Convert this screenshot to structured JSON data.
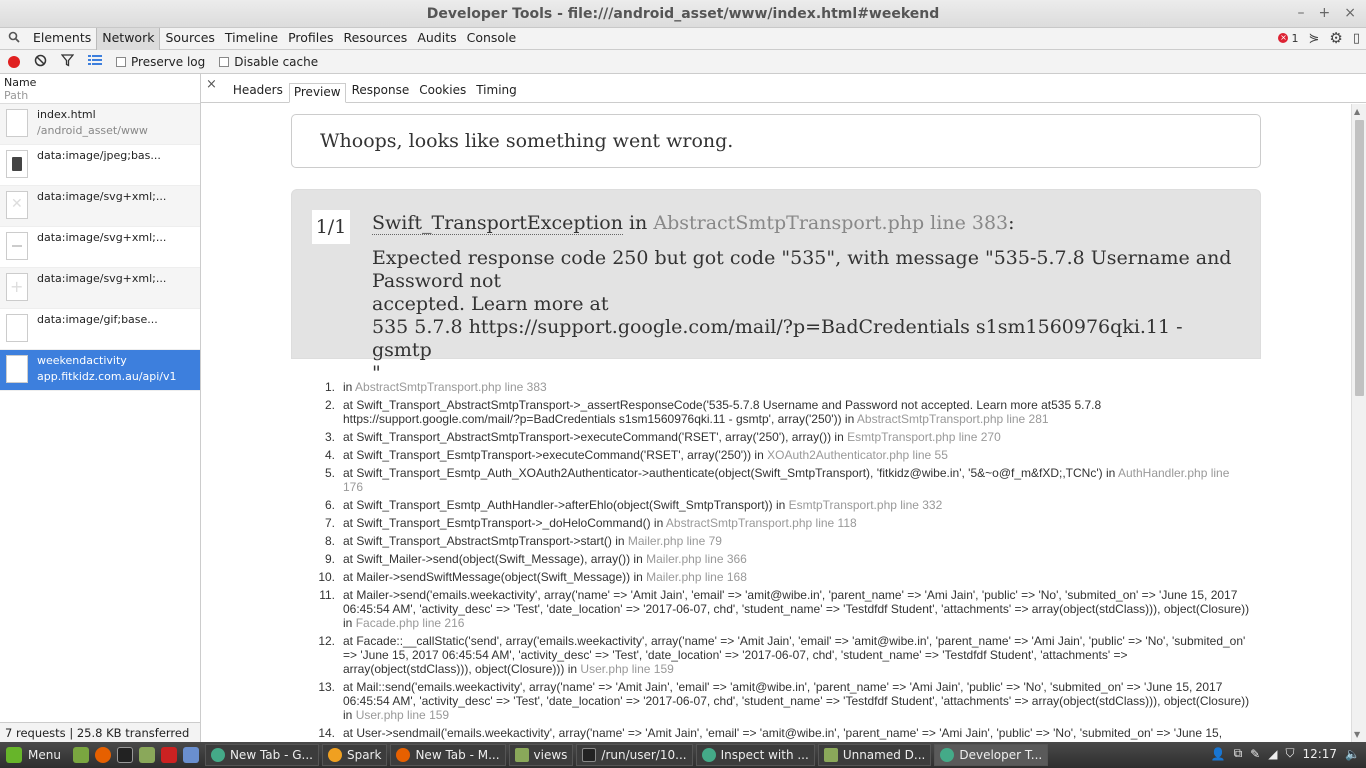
{
  "window": {
    "title": "Developer Tools - file:///android_asset/www/index.html#weekend"
  },
  "devtools_tabs": [
    "Elements",
    "Network",
    "Sources",
    "Timeline",
    "Profiles",
    "Resources",
    "Audits",
    "Console"
  ],
  "error_count": "1",
  "toolbar": {
    "preserve_log": "Preserve log",
    "disable_cache": "Disable cache"
  },
  "list": {
    "name_header": "Name",
    "path_header": "Path",
    "requests": [
      {
        "name": "index.html",
        "path": "/android_asset/www"
      },
      {
        "name": "data:image/jpeg;bas...",
        "path": ""
      },
      {
        "name": "data:image/svg+xml;...",
        "path": ""
      },
      {
        "name": "data:image/svg+xml;...",
        "path": ""
      },
      {
        "name": "data:image/svg+xml;...",
        "path": ""
      },
      {
        "name": "data:image/gif;base...",
        "path": ""
      },
      {
        "name": "weekendactivity",
        "path": "app.fitkidz.com.au/api/v1"
      }
    ],
    "footer": "7 requests  |  25.8 KB transferred"
  },
  "detail_tabs": [
    "Headers",
    "Preview",
    "Response",
    "Cookies",
    "Timing"
  ],
  "preview": {
    "whoops": "Whoops, looks like something went wrong.",
    "counter": "1/1",
    "exception_class": "Swift_TransportException",
    "in_text": "in",
    "exception_file": "AbstractSmtpTransport.php line 383",
    "message_lines": [
      "Expected response code 250 but got code \"535\", with message \"535-5.7.8 Username and Password not",
      "accepted. Learn more at",
      "535 5.7.8 https://support.google.com/mail/?p=BadCredentials s1sm1560976qki.11 - gsmtp",
      "\""
    ],
    "trace": [
      {
        "no": "1.",
        "text": "in",
        "file": "AbstractSmtpTransport.php line 383"
      },
      {
        "no": "2.",
        "text": "at Swift_Transport_AbstractSmtpTransport->_assertResponseCode('535-5.7.8 Username and Password not accepted. Learn more at535 5.7.8 https://support.google.com/mail/?p=BadCredentials s1sm1560976qki.11 - gsmtp', array('250')) in",
        "file": "AbstractSmtpTransport.php line 281"
      },
      {
        "no": "3.",
        "text": "at Swift_Transport_AbstractSmtpTransport->executeCommand('RSET', array('250'), array()) in",
        "file": "EsmtpTransport.php line 270"
      },
      {
        "no": "4.",
        "text": "at Swift_Transport_EsmtpTransport->executeCommand('RSET', array('250')) in",
        "file": "XOAuth2Authenticator.php line 55"
      },
      {
        "no": "5.",
        "text": "at Swift_Transport_Esmtp_Auth_XOAuth2Authenticator->authenticate(object(Swift_SmtpTransport), 'fitkidz@wibe.in', '5&~o@f_m&fXD;,TCNc') in",
        "file": "AuthHandler.php line 176"
      },
      {
        "no": "6.",
        "text": "at Swift_Transport_Esmtp_AuthHandler->afterEhlo(object(Swift_SmtpTransport)) in",
        "file": "EsmtpTransport.php line 332"
      },
      {
        "no": "7.",
        "text": "at Swift_Transport_EsmtpTransport->_doHeloCommand() in",
        "file": "AbstractSmtpTransport.php line 118"
      },
      {
        "no": "8.",
        "text": "at Swift_Transport_AbstractSmtpTransport->start() in",
        "file": "Mailer.php line 79"
      },
      {
        "no": "9.",
        "text": "at Swift_Mailer->send(object(Swift_Message), array()) in",
        "file": "Mailer.php line 366"
      },
      {
        "no": "10.",
        "text": "at Mailer->sendSwiftMessage(object(Swift_Message)) in",
        "file": "Mailer.php line 168"
      },
      {
        "no": "11.",
        "text": "at Mailer->send('emails.weekactivity', array('name' => 'Amit Jain', 'email' => 'amit@wibe.in', 'parent_name' => 'Ami Jain', 'public' => 'No', 'submited_on' => 'June 15, 2017 06:45:54 AM', 'activity_desc' => 'Test', 'date_location' => '2017-06-07, chd', 'student_name' => 'Testdfdf Student', 'attachments' => array(object(stdClass))), object(Closure)) in",
        "file": "Facade.php line 216"
      },
      {
        "no": "12.",
        "text": "at Facade::__callStatic('send', array('emails.weekactivity', array('name' => 'Amit Jain', 'email' => 'amit@wibe.in', 'parent_name' => 'Ami Jain', 'public' => 'No', 'submited_on' => 'June 15, 2017 06:45:54 AM', 'activity_desc' => 'Test', 'date_location' => '2017-06-07, chd', 'student_name' => 'Testdfdf Student', 'attachments' => array(object(stdClass))), object(Closure))) in",
        "file": "User.php line 159"
      },
      {
        "no": "13.",
        "text": "at Mail::send('emails.weekactivity', array('name' => 'Amit Jain', 'email' => 'amit@wibe.in', 'parent_name' => 'Ami Jain', 'public' => 'No', 'submited_on' => 'June 15, 2017 06:45:54 AM', 'activity_desc' => 'Test', 'date_location' => '2017-06-07, chd', 'student_name' => 'Testdfdf Student', 'attachments' => array(object(stdClass))), object(Closure)) in",
        "file": "User.php line 159"
      },
      {
        "no": "14.",
        "text": "at User->sendmail('emails.weekactivity', array('name' => 'Amit Jain', 'email' => 'amit@wibe.in', 'parent_name' => 'Ami Jain', 'public' => 'No', 'submited_on' => 'June 15,",
        "file": ""
      }
    ]
  },
  "taskbar": {
    "menu_label": "Menu",
    "tasks": [
      "New Tab - G...",
      "Spark",
      "New Tab - M...",
      "views",
      "/run/user/10...",
      "Inspect with ...",
      "Unnamed D...",
      "Developer T..."
    ],
    "clock": "12:17"
  },
  "colors": {
    "record": "#e02020",
    "selected": "#3d7fdd",
    "error": "#dd2233"
  }
}
